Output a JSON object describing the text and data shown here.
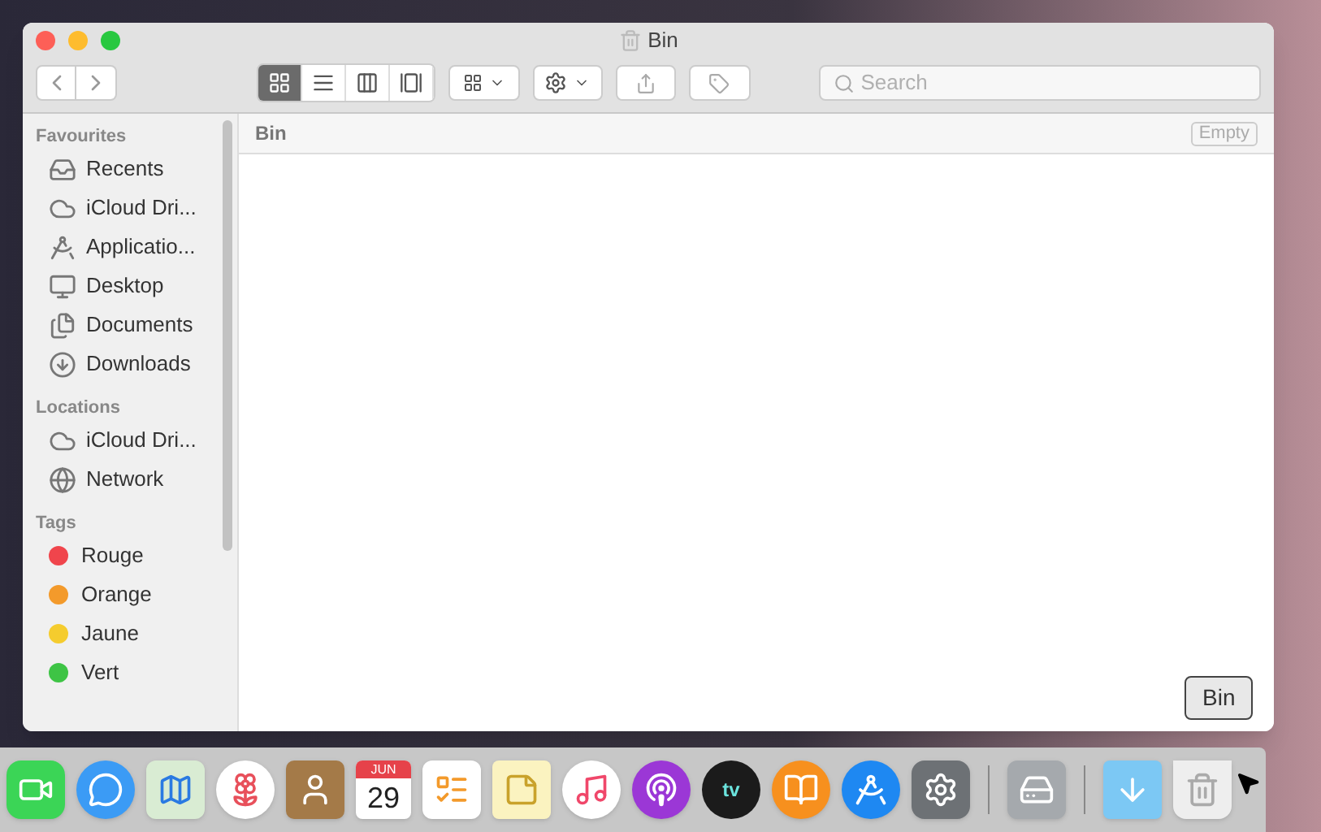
{
  "window": {
    "title": "Bin"
  },
  "toolbar": {
    "views": [
      {
        "kind": "icons",
        "selected": true
      },
      {
        "kind": "list",
        "selected": false
      },
      {
        "kind": "columns",
        "selected": false
      },
      {
        "kind": "gallery",
        "selected": false
      }
    ],
    "search": {
      "placeholder": "Search"
    }
  },
  "sidebar": {
    "sections": [
      {
        "title": "Favourites",
        "items": [
          {
            "label": "Recents",
            "kind": "recents"
          },
          {
            "label": "iCloud Dri...",
            "kind": "cloud"
          },
          {
            "label": "Applicatio...",
            "kind": "apps"
          },
          {
            "label": "Desktop",
            "kind": "desktop"
          },
          {
            "label": "Documents",
            "kind": "documents"
          },
          {
            "label": "Downloads",
            "kind": "downloads"
          }
        ]
      },
      {
        "title": "Locations",
        "items": [
          {
            "label": "iCloud Dri...",
            "kind": "cloud"
          },
          {
            "label": "Network",
            "kind": "network"
          }
        ]
      },
      {
        "title": "Tags",
        "items": [
          {
            "label": "Rouge",
            "kind": "tag",
            "color": "#f0454c"
          },
          {
            "label": "Orange",
            "kind": "tag",
            "color": "#f39a2b"
          },
          {
            "label": "Jaune",
            "kind": "tag",
            "color": "#f5cc2e"
          },
          {
            "label": "Vert",
            "kind": "tag",
            "color": "#3ec445"
          }
        ]
      }
    ]
  },
  "path_bar": {
    "folder": "Bin",
    "action": "Empty"
  },
  "tooltip": "Bin",
  "dock": [
    {
      "kind": "facetime"
    },
    {
      "kind": "messages"
    },
    {
      "kind": "maps"
    },
    {
      "kind": "photos"
    },
    {
      "kind": "contacts"
    },
    {
      "kind": "calendar",
      "month": "JUN",
      "day": "29"
    },
    {
      "kind": "reminders"
    },
    {
      "kind": "notes"
    },
    {
      "kind": "music"
    },
    {
      "kind": "podcasts"
    },
    {
      "kind": "tv",
      "text": "tv"
    },
    {
      "kind": "books"
    },
    {
      "kind": "appstore"
    },
    {
      "kind": "settings"
    },
    {
      "kind": "separator"
    },
    {
      "kind": "diskutility"
    },
    {
      "kind": "separator"
    },
    {
      "kind": "downloads"
    },
    {
      "kind": "bin"
    }
  ]
}
